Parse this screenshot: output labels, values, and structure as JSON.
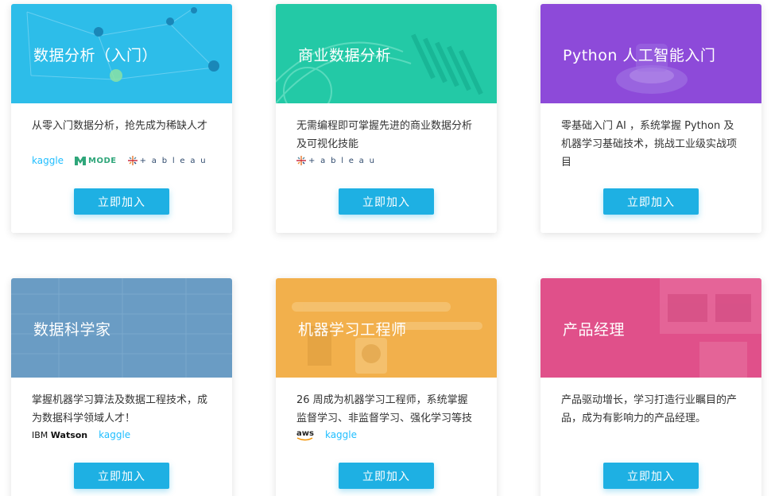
{
  "button_label": "立即加入",
  "cards": [
    {
      "title": "数据分析（入门）",
      "desc": "从零入门数据分析，抢先成为稀缺人才",
      "color": "#2dbde9",
      "logos": [
        "kaggle",
        "MODE",
        "tableau"
      ]
    },
    {
      "title": "商业数据分析",
      "desc": "无需编程即可掌握先进的商业数据分析及可视化技能",
      "color": "#23c9a6",
      "logos": [
        "tableau"
      ]
    },
    {
      "title": "Python 人工智能入门",
      "desc": "零基础入门 AI ，系统掌握 Python 及机器学习基础技术，挑战工业级实战项目",
      "color": "#8d4ad9",
      "logos": []
    },
    {
      "title": "数据科学家",
      "desc": "掌握机器学习算法及数据工程技术，成为数据科学领域人才！",
      "color": "#6a9cc4",
      "logos": [
        "IBM Watson",
        "kaggle"
      ]
    },
    {
      "title": "机器学习工程师",
      "desc": "26 周成为机器学习工程师，系统掌握监督学习、非监督学习、强化学习等技",
      "color": "#f2b04c",
      "logos": [
        "aws",
        "kaggle"
      ]
    },
    {
      "title": "产品经理",
      "desc": "产品驱动增长，学习打造行业瞩目的产品，成为有影响力的产品经理。",
      "color": "#e0508a",
      "logos": []
    }
  ],
  "logo_text": {
    "kaggle": "kaggle",
    "mode": "MODE",
    "tableau": "+ a b l e a u",
    "ibm": "IBM",
    "watson": "Watson",
    "aws": "aws"
  }
}
